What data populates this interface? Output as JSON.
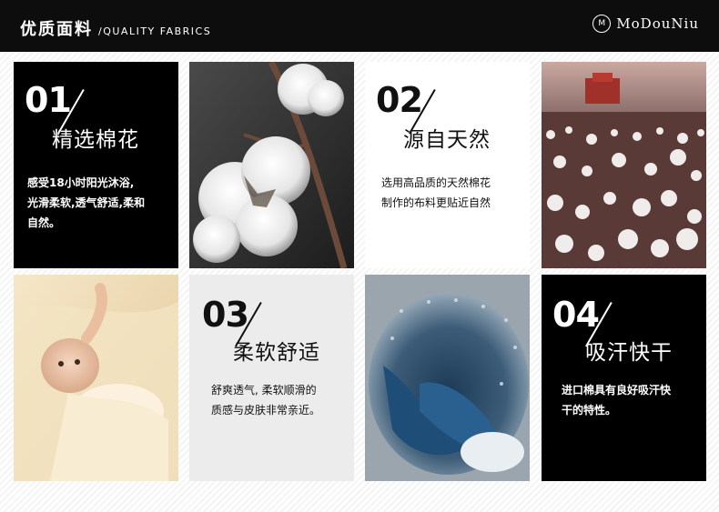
{
  "header": {
    "title_cn": "优质面料",
    "title_en": "/QUALITY FABRICS",
    "brand": "MoDouNiu",
    "logo_mark": "M"
  },
  "tiles": [
    {
      "num": "01",
      "title": "精选棉花",
      "desc": [
        "感受18小时阳光沐浴,",
        "光滑柔软,透气舒适,柔和",
        "自然。"
      ]
    },
    {
      "num": "02",
      "title": "源自天然",
      "desc": [
        "选用高品质的天然棉花",
        "制作的布料更贴近自然"
      ]
    },
    {
      "num": "03",
      "title": "柔软舒适",
      "desc": [
        "舒爽透气, 柔软顺滑的",
        "质感与皮肤非常亲近。"
      ]
    },
    {
      "num": "04",
      "title": "吸汗快干",
      "desc": [
        "进口棉具有良好吸汗快",
        "干的特性。"
      ]
    }
  ],
  "photos": {
    "cotton_boll": "cotton-boll-photo",
    "cotton_field": "cotton-field-photo",
    "baby": "baby-photo",
    "washing_machine": "washing-machine-photo"
  },
  "colors": {
    "dark": "#000000",
    "light": "#ececec",
    "header": "#0d0d0d"
  }
}
